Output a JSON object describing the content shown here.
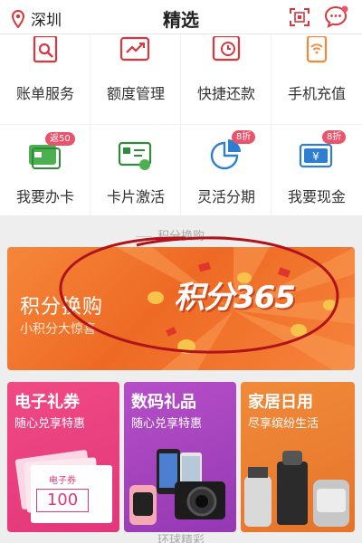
{
  "header": {
    "location": "深圳",
    "title": "精选"
  },
  "grid": {
    "items": [
      {
        "label": "账单服务",
        "icon": "bill-service-icon"
      },
      {
        "label": "额度管理",
        "icon": "credit-limit-icon"
      },
      {
        "label": "快捷还款",
        "icon": "quick-repay-icon"
      },
      {
        "label": "手机充值",
        "icon": "mobile-recharge-icon"
      },
      {
        "label": "我要办卡",
        "icon": "apply-card-icon",
        "badge": "返50"
      },
      {
        "label": "卡片激活",
        "icon": "card-activate-icon"
      },
      {
        "label": "灵活分期",
        "icon": "installment-icon",
        "badge": "8折"
      },
      {
        "label": "我要现金",
        "icon": "cash-icon",
        "badge": "8折"
      }
    ]
  },
  "section": {
    "points_title": "积分换购",
    "global_title": "环球精彩"
  },
  "banner": {
    "title": "积分换购",
    "subtitle": "小积分大惊喜",
    "logo": "积分365"
  },
  "cards": [
    {
      "title": "电子礼券",
      "subtitle": "随心兑享特惠",
      "ticket_label": "电子券",
      "ticket_value": "100"
    },
    {
      "title": "数码礼品",
      "subtitle": "随心兑享特惠"
    },
    {
      "title": "家居日用",
      "subtitle": "尽享缤纷生活"
    }
  ],
  "colors": {
    "brand_red": "#e2377a",
    "banner_orange": "#ee6a24",
    "icon_red": "#d9363e"
  }
}
